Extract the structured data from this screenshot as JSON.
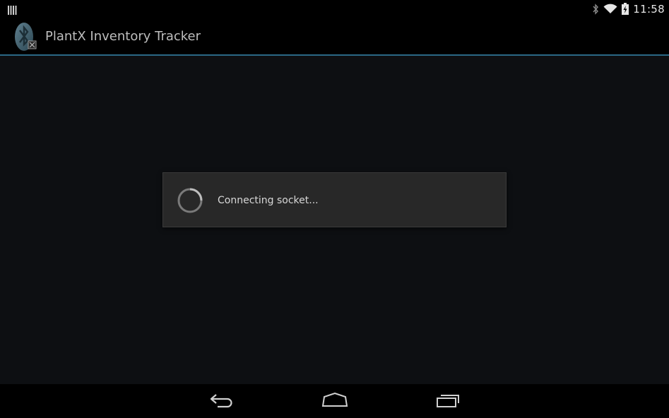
{
  "status_bar": {
    "time": "11:58",
    "icons": [
      "notification-icon",
      "bluetooth-icon",
      "wifi-icon",
      "battery-charging-icon"
    ]
  },
  "action_bar": {
    "title": "PlantX Inventory Tracker",
    "icon": "bluetooth-app-icon",
    "divider_color": "#2a6886"
  },
  "dialog": {
    "message": "Connecting socket...",
    "icon": "progress-spinner-icon"
  },
  "nav_bar": {
    "buttons": [
      "back-icon",
      "home-icon",
      "recents-icon"
    ]
  }
}
